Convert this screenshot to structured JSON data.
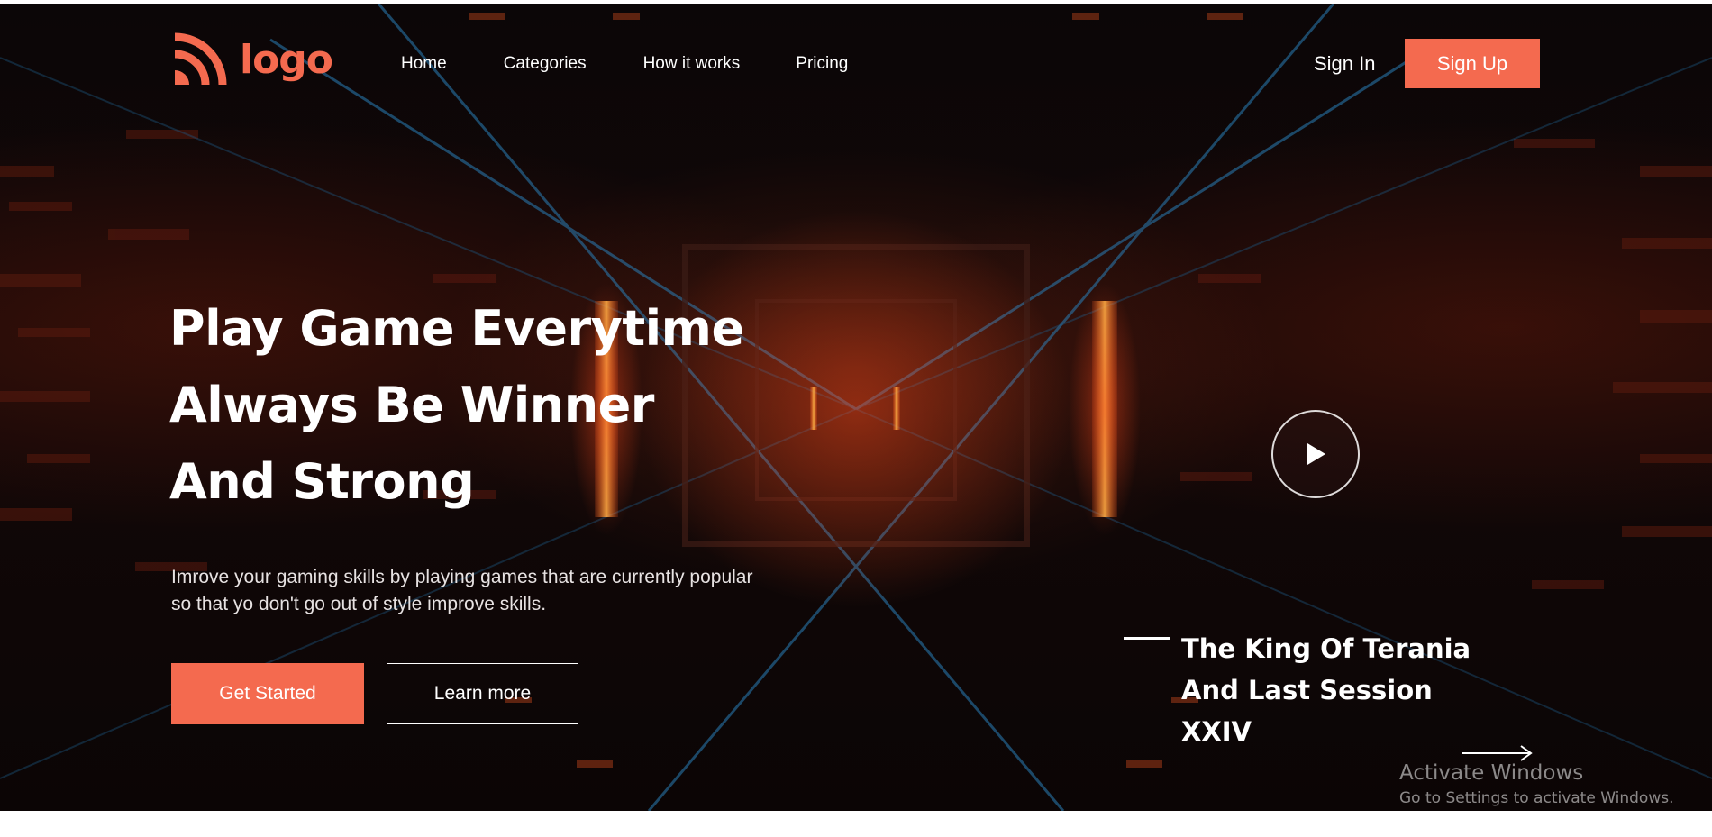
{
  "brand": {
    "logo_text": "logo",
    "accent_color": "#f46a4f",
    "icon": "wave-arcs-icon"
  },
  "nav": {
    "items": [
      {
        "label": "Home"
      },
      {
        "label": "Categories"
      },
      {
        "label": "How it works"
      },
      {
        "label": "Pricing"
      }
    ],
    "sign_in": "Sign In",
    "sign_up": "Sign Up"
  },
  "hero": {
    "headline": [
      "Play Game Everytime",
      "Always Be Winner",
      "And Strong"
    ],
    "description": "Imrove your gaming skills by playing games that are currently popular so that yo don't go out of style improve skills.",
    "primary_button": "Get Started",
    "secondary_button": "Learn more",
    "play_icon": "play-icon"
  },
  "feature": {
    "title_lines": [
      "The King Of Terania",
      "And Last Session",
      "XXIV"
    ],
    "arrow_icon": "arrow-right-icon"
  },
  "watermark": {
    "title": "Activate Windows",
    "subtitle": "Go to Settings to activate Windows."
  }
}
